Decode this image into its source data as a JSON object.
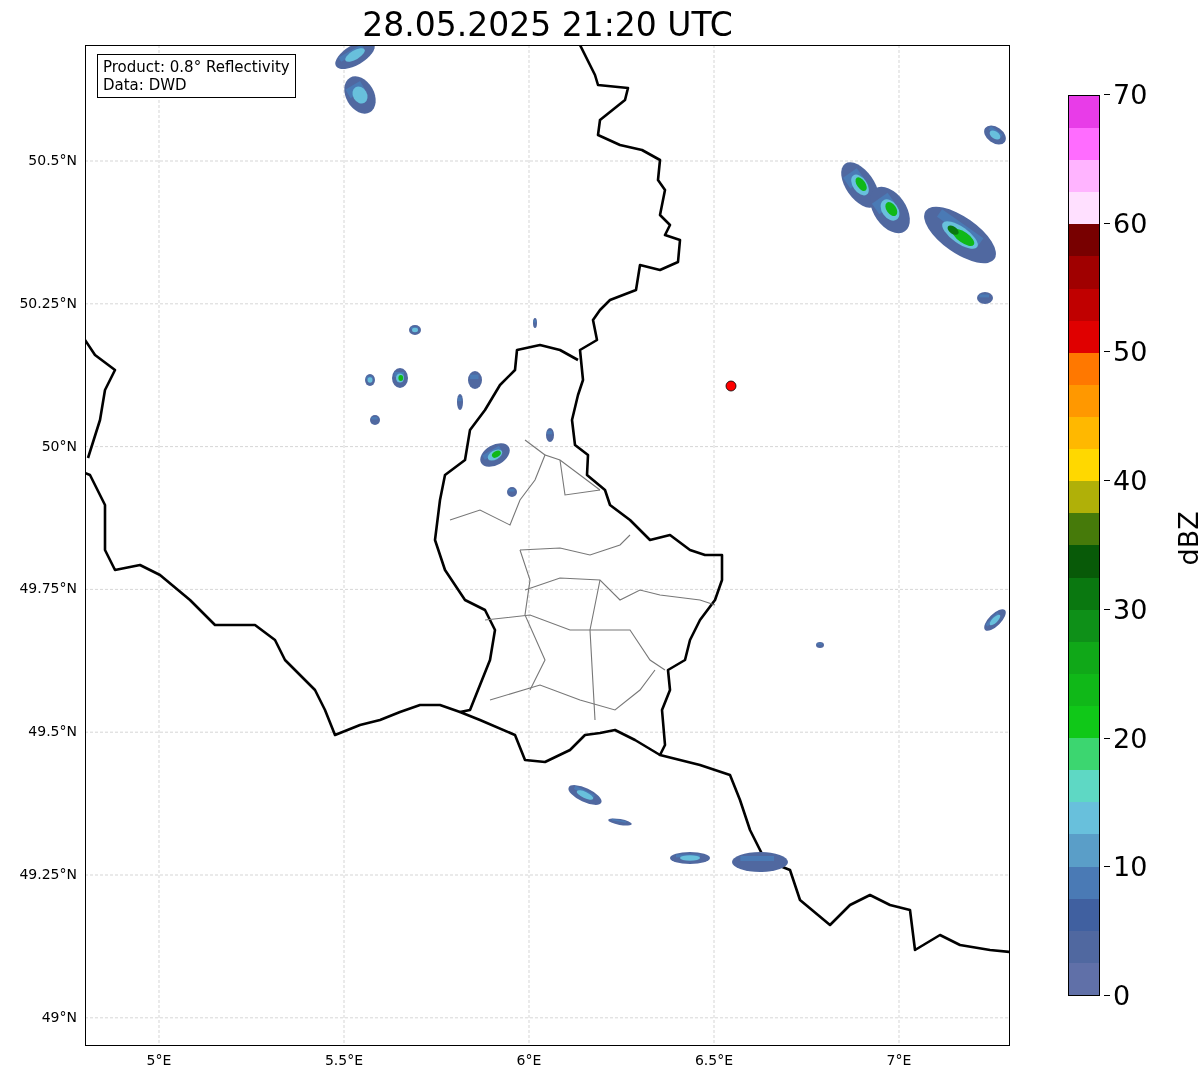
{
  "title": "28.05.2025 21:20 UTC",
  "info_box": {
    "lines": [
      "Product: 0.8° Reflectivity",
      "Data: DWD"
    ]
  },
  "y_tick_labels": [
    "50.5°N",
    "50.25°N",
    "50°N",
    "49.75°N",
    "49.5°N",
    "49.25°N",
    "49°N"
  ],
  "x_tick_labels": [
    "5°E",
    "5.5°E",
    "6°E",
    "6.5°E",
    "7°E"
  ],
  "colorbar": {
    "label": "dBZ",
    "tick_labels": [
      "70",
      "60",
      "50",
      "40",
      "30",
      "20",
      "10",
      "0"
    ],
    "bins": [
      {
        "color": "#6070a8"
      },
      {
        "color": "#5068a0"
      },
      {
        "color": "#4060a0"
      },
      {
        "color": "#4a7ab5"
      },
      {
        "color": "#5a9ec8"
      },
      {
        "color": "#68c0dc"
      },
      {
        "color": "#5ed8c4"
      },
      {
        "color": "#3cd670"
      },
      {
        "color": "#10c818"
      },
      {
        "color": "#10b818"
      },
      {
        "color": "#10a818"
      },
      {
        "color": "#0e9018"
      },
      {
        "color": "#0a7810"
      },
      {
        "color": "#085a08"
      },
      {
        "color": "#467a0a"
      },
      {
        "color": "#b0b008"
      },
      {
        "color": "#ffd800"
      },
      {
        "color": "#ffb800"
      },
      {
        "color": "#ff9800"
      },
      {
        "color": "#ff7800"
      },
      {
        "color": "#e00000"
      },
      {
        "color": "#c00000"
      },
      {
        "color": "#a00000"
      },
      {
        "color": "#780000"
      },
      {
        "color": "#ffe0ff"
      },
      {
        "color": "#ffb4ff"
      },
      {
        "color": "#ff6cff"
      },
      {
        "color": "#e83ce8"
      }
    ]
  }
}
